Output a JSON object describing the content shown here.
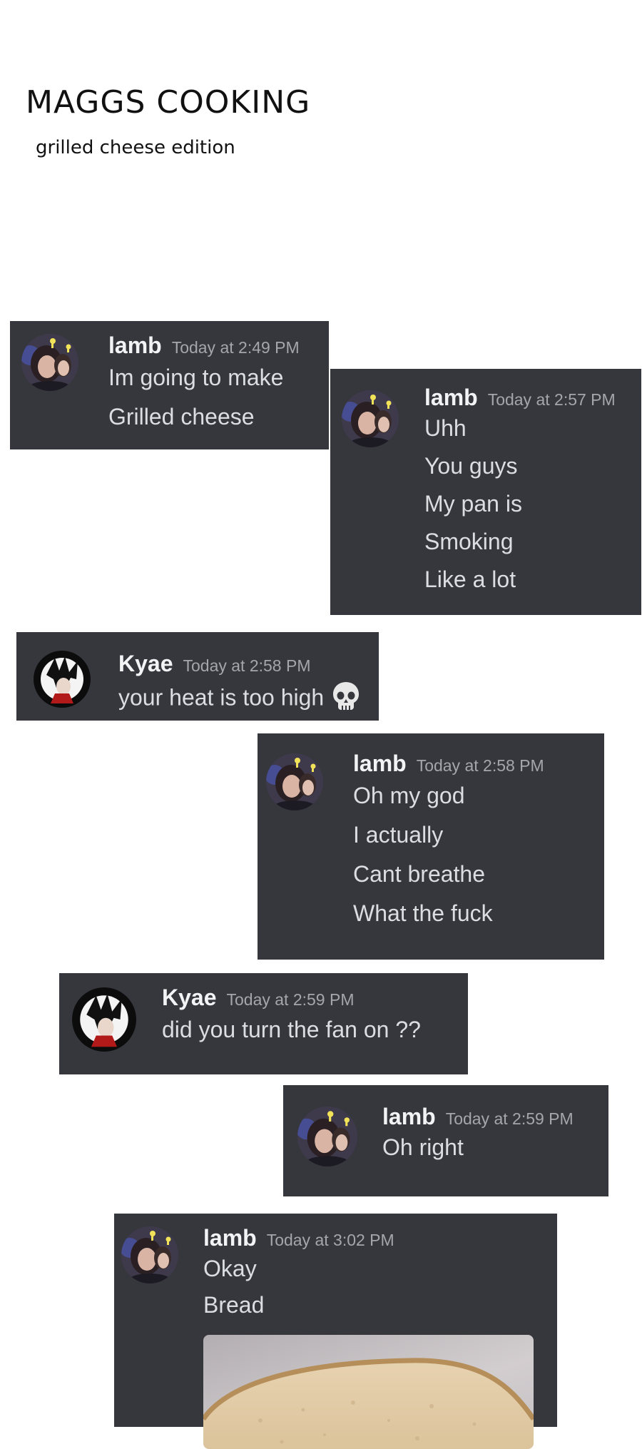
{
  "header": {
    "title": "MAGGS COOKING",
    "subtitle": "grilled cheese edition"
  },
  "colors": {
    "message_bg": "#36373d",
    "username": "#f2f3f5",
    "timestamp": "#a3a6aa",
    "text": "#dbdee1"
  },
  "messages": [
    {
      "user": "lamb",
      "time": "Today at 2:49 PM",
      "avatar": "lamb-avatar",
      "lines": [
        "Im going to make",
        "Grilled cheese"
      ]
    },
    {
      "user": "lamb",
      "time": "Today at 2:57 PM",
      "avatar": "lamb-avatar",
      "lines": [
        "Uhh",
        "You guys",
        "My pan is",
        "Smoking",
        "Like a lot"
      ]
    },
    {
      "user": "Kyae",
      "time": "Today at 2:58 PM",
      "avatar": "kyae-avatar",
      "lines": [
        "your heat is too  high"
      ],
      "emoji": "skull-emoji"
    },
    {
      "user": "lamb",
      "time": "Today at 2:58 PM",
      "avatar": "lamb-avatar",
      "lines": [
        "Oh my god",
        "I actually",
        "Cant breathe",
        "What the fuck"
      ]
    },
    {
      "user": "Kyae",
      "time": "Today at 2:59 PM",
      "avatar": "kyae-avatar",
      "lines": [
        "did you turn the fan on ??"
      ]
    },
    {
      "user": "lamb",
      "time": "Today at 2:59 PM",
      "avatar": "lamb-avatar",
      "lines": [
        "Oh right"
      ]
    },
    {
      "user": "lamb",
      "time": "Today at 3:02 PM",
      "avatar": "lamb-avatar",
      "lines": [
        "Okay",
        "Bread"
      ],
      "attachment": "bread-photo"
    }
  ]
}
